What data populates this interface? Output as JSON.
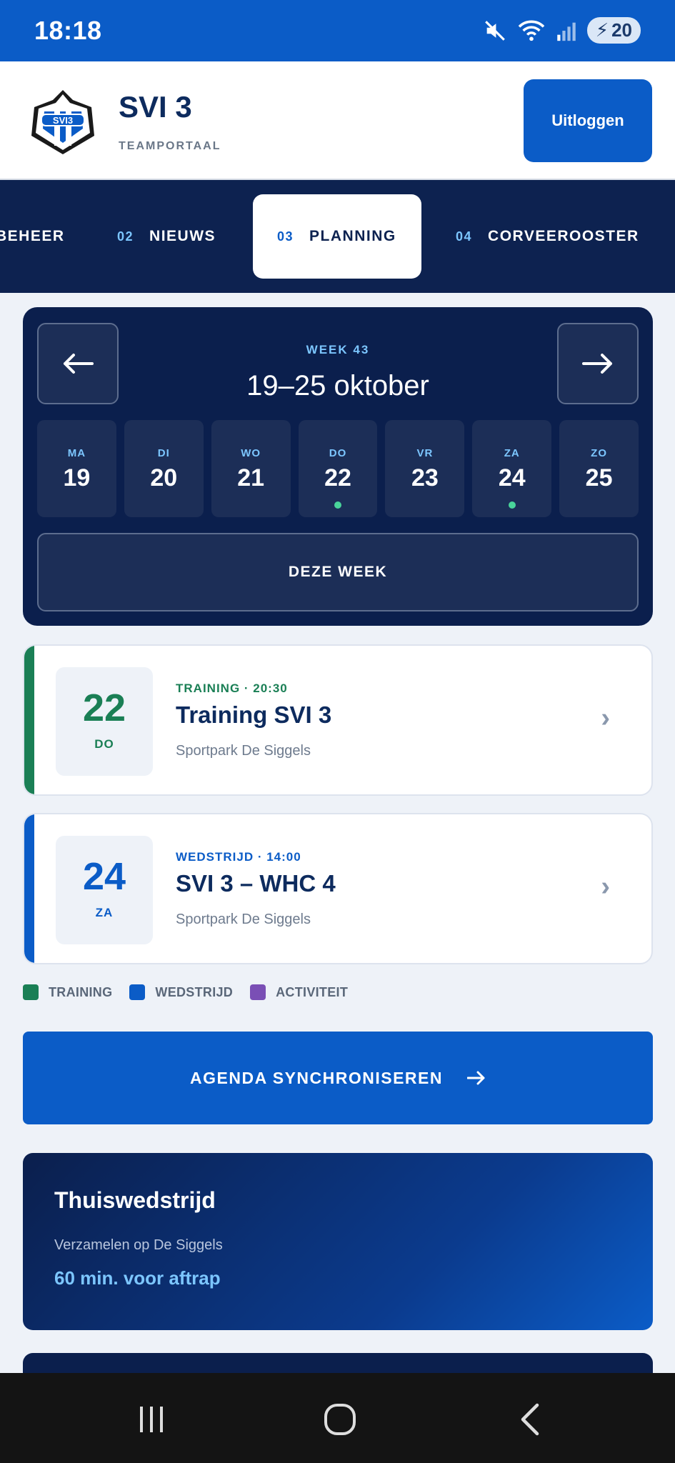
{
  "status_bar": {
    "time": "18:18",
    "battery": "20"
  },
  "header": {
    "team_name": "SVI 3",
    "subtitle": "TEAMPORTAAL",
    "logout_label": "Uitloggen",
    "logo_text": "SVI3"
  },
  "tabs": [
    {
      "num": "",
      "label": "BEHEER"
    },
    {
      "num": "02",
      "label": "NIEUWS"
    },
    {
      "num": "03",
      "label": "PLANNING",
      "active": true
    },
    {
      "num": "04",
      "label": "CORVEEROOSTER"
    }
  ],
  "week": {
    "label": "WEEK 43",
    "range": "19–25 oktober",
    "prev_icon": "arrow-left-icon",
    "next_icon": "arrow-right-icon",
    "this_week_label": "DEZE WEEK",
    "days": [
      {
        "name": "MA",
        "date": "19",
        "has_event": false
      },
      {
        "name": "DI",
        "date": "20",
        "has_event": false
      },
      {
        "name": "WO",
        "date": "21",
        "has_event": false
      },
      {
        "name": "DO",
        "date": "22",
        "has_event": true
      },
      {
        "name": "VR",
        "date": "23",
        "has_event": false
      },
      {
        "name": "ZA",
        "date": "24",
        "has_event": true
      },
      {
        "name": "ZO",
        "date": "25",
        "has_event": false
      }
    ]
  },
  "events": [
    {
      "day": "22",
      "dayname": "DO",
      "meta": "TRAINING · 20:30",
      "title": "Training SVI 3",
      "location": "Sportpark De Siggels",
      "color": "#1a7f55"
    },
    {
      "day": "24",
      "dayname": "ZA",
      "meta": "WEDSTRIJD · 14:00",
      "title": "SVI 3 – WHC 4",
      "location": "Sportpark De Siggels",
      "color": "#0b5cc7"
    }
  ],
  "legend": [
    {
      "label": "TRAINING",
      "color": "#1a7f55"
    },
    {
      "label": "WEDSTRIJD",
      "color": "#0b5cc7"
    },
    {
      "label": "ACTIVITEIT",
      "color": "#7a4fb5"
    }
  ],
  "sync": {
    "label": "AGENDA SYNCHRONISEREN",
    "icon": "arrow-right-icon"
  },
  "home_card": {
    "title": "Thuiswedstrijd",
    "subtitle": "Verzamelen op De Siggels",
    "value": "60 min. voor aftrap"
  },
  "colors": {
    "primary": "#0b5cc7",
    "navy": "#0b1f4d",
    "accent": "#7cc6ff",
    "training": "#1a7f55",
    "activity": "#7a4fb5"
  }
}
